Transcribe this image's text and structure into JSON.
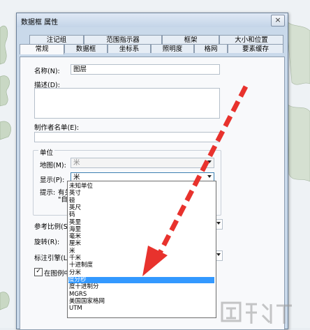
{
  "dialog": {
    "title": "数据框 属性",
    "close_glyph": "×"
  },
  "tabs_row1": [
    "注记组",
    "范围指示器",
    "框架",
    "大小和位置"
  ],
  "tabs_row2": [
    "常规",
    "数据框",
    "坐标系",
    "照明度",
    "格网",
    "要素缓存"
  ],
  "active_tab": "常规",
  "form": {
    "name_label": "名称(N):",
    "name_value": "图层",
    "desc_label": "描述(D):",
    "author_label": "制作者名单(E):",
    "units_group": "单位",
    "map_label": "地图(M):",
    "map_value": "米",
    "display_label": "显示(P):",
    "display_value": "米",
    "hint_label": "提示:",
    "hint_text_1": "有关",
    "hint_text_2": "\"自定",
    "ref_scale_label": "参考比例(S)",
    "rotation_label": "旋转(R):",
    "label_engine_label": "标注引擎(L):",
    "checkbox_label": "在图例中"
  },
  "dropdown_options": [
    "未知单位",
    "英寸",
    "磅",
    "英尺",
    "码",
    "英里",
    "海里",
    "毫米",
    "厘米",
    "米",
    "千米",
    "十进制度",
    "分米",
    "度分秒",
    "度十进制分",
    "MGRS",
    "美国国家格网",
    "UTM"
  ],
  "selected_option": "度分秒",
  "colors": {
    "selection": "#3399ff",
    "arrow": "#e8322d"
  }
}
